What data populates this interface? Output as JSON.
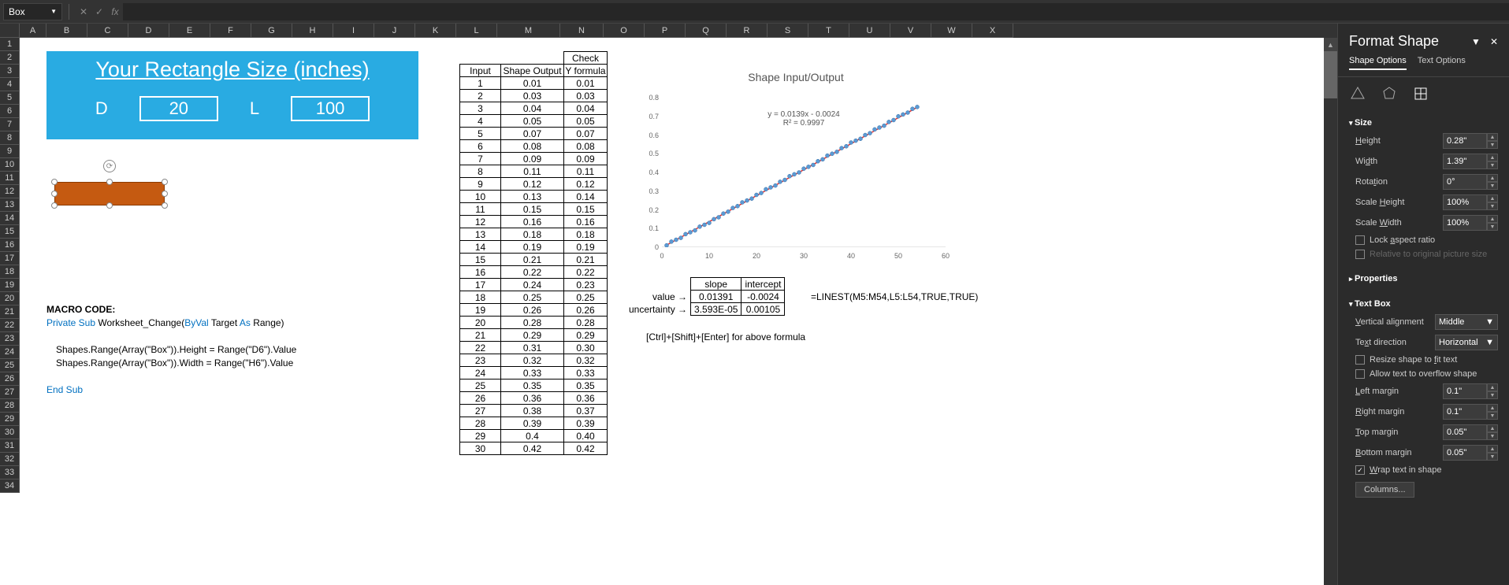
{
  "name_box": "Box",
  "columns": [
    "A",
    "B",
    "C",
    "D",
    "E",
    "F",
    "G",
    "H",
    "I",
    "J",
    "K",
    "L",
    "M",
    "N",
    "O",
    "P",
    "Q",
    "R",
    "S",
    "T",
    "U",
    "V",
    "W",
    "X"
  ],
  "row_count": 34,
  "banner": {
    "title": "Your Rectangle Size (inches)",
    "d_label": "D",
    "d_value": "20",
    "l_label": "L",
    "l_value": "100"
  },
  "macro": {
    "heading": "MACRO CODE:",
    "l1a": "Private Sub",
    "l1b": " Worksheet_Change(",
    "l1c": "ByVal",
    "l1d": " Target ",
    "l1e": "As",
    "l1f": " Range)",
    "l2": "Shapes.Range(Array(\"Box\")).Height = Range(\"D6\").Value",
    "l3": "Shapes.Range(Array(\"Box\")).Width = Range(\"H6\").Value",
    "l4": "End Sub"
  },
  "dtable": {
    "check_label": "Check",
    "h_input": "Input",
    "h_shape": "Shape Output",
    "h_y": "Y formula",
    "rows": [
      [
        "1",
        "0.01",
        "0.01"
      ],
      [
        "2",
        "0.03",
        "0.03"
      ],
      [
        "3",
        "0.04",
        "0.04"
      ],
      [
        "4",
        "0.05",
        "0.05"
      ],
      [
        "5",
        "0.07",
        "0.07"
      ],
      [
        "6",
        "0.08",
        "0.08"
      ],
      [
        "7",
        "0.09",
        "0.09"
      ],
      [
        "8",
        "0.11",
        "0.11"
      ],
      [
        "9",
        "0.12",
        "0.12"
      ],
      [
        "10",
        "0.13",
        "0.14"
      ],
      [
        "11",
        "0.15",
        "0.15"
      ],
      [
        "12",
        "0.16",
        "0.16"
      ],
      [
        "13",
        "0.18",
        "0.18"
      ],
      [
        "14",
        "0.19",
        "0.19"
      ],
      [
        "15",
        "0.21",
        "0.21"
      ],
      [
        "16",
        "0.22",
        "0.22"
      ],
      [
        "17",
        "0.24",
        "0.23"
      ],
      [
        "18",
        "0.25",
        "0.25"
      ],
      [
        "19",
        "0.26",
        "0.26"
      ],
      [
        "20",
        "0.28",
        "0.28"
      ],
      [
        "21",
        "0.29",
        "0.29"
      ],
      [
        "22",
        "0.31",
        "0.30"
      ],
      [
        "23",
        "0.32",
        "0.32"
      ],
      [
        "24",
        "0.33",
        "0.33"
      ],
      [
        "25",
        "0.35",
        "0.35"
      ],
      [
        "26",
        "0.36",
        "0.36"
      ],
      [
        "27",
        "0.38",
        "0.37"
      ],
      [
        "28",
        "0.39",
        "0.39"
      ],
      [
        "29",
        "0.4",
        "0.40"
      ],
      [
        "30",
        "0.42",
        "0.42"
      ]
    ]
  },
  "stats": {
    "h_slope": "slope",
    "h_int": "intercept",
    "r_val": "value →",
    "v_slope": "0.01391",
    "v_int": "-0.0024",
    "r_unc": "uncertainty →",
    "u_slope": "3.593E-05",
    "u_int": "0.00105"
  },
  "formula_text": "=LINEST(M5:M54,L5:L54,TRUE,TRUE)",
  "hint_text": "[Ctrl]+[Shift]+[Enter] for above formula",
  "chart_data": {
    "type": "scatter",
    "title": "Shape Input/Output",
    "xlabel": "",
    "ylabel": "",
    "xlim": [
      0,
      60
    ],
    "ylim": [
      0,
      0.8
    ],
    "x_ticks": [
      0,
      10,
      20,
      30,
      40,
      50,
      60
    ],
    "y_ticks": [
      0,
      0.1,
      0.2,
      0.3,
      0.4,
      0.5,
      0.6,
      0.7,
      0.8
    ],
    "eq": "y = 0.0139x - 0.0024",
    "r2": "R² = 0.9997",
    "series": [
      {
        "name": "Shape Output",
        "x": [
          1,
          2,
          3,
          4,
          5,
          6,
          7,
          8,
          9,
          10,
          11,
          12,
          13,
          14,
          15,
          16,
          17,
          18,
          19,
          20,
          21,
          22,
          23,
          24,
          25,
          26,
          27,
          28,
          29,
          30,
          31,
          32,
          33,
          34,
          35,
          36,
          37,
          38,
          39,
          40,
          41,
          42,
          43,
          44,
          45,
          46,
          47,
          48,
          49,
          50,
          51,
          52,
          53,
          54
        ],
        "y": [
          0.01,
          0.03,
          0.04,
          0.05,
          0.07,
          0.08,
          0.09,
          0.11,
          0.12,
          0.13,
          0.15,
          0.16,
          0.18,
          0.19,
          0.21,
          0.22,
          0.24,
          0.25,
          0.26,
          0.28,
          0.29,
          0.31,
          0.32,
          0.33,
          0.35,
          0.36,
          0.38,
          0.39,
          0.4,
          0.42,
          0.43,
          0.44,
          0.46,
          0.47,
          0.49,
          0.5,
          0.51,
          0.53,
          0.54,
          0.56,
          0.57,
          0.58,
          0.6,
          0.61,
          0.63,
          0.64,
          0.65,
          0.67,
          0.68,
          0.7,
          0.71,
          0.72,
          0.74,
          0.75
        ]
      }
    ],
    "trendline": {
      "slope": 0.0139,
      "intercept": -0.0024
    }
  },
  "panel": {
    "title": "Format Shape",
    "tab1": "Shape Options",
    "tab2": "Text Options",
    "size": {
      "head": "Size",
      "height_l": "Height",
      "height_v": "0.28\"",
      "width_l": "Width",
      "width_v": "1.39\"",
      "rotation_l": "Rotation",
      "rotation_v": "0°",
      "sh_l": "Scale Height",
      "sh_v": "100%",
      "sw_l": "Scale Width",
      "sw_v": "100%",
      "lock": "Lock aspect ratio",
      "relative": "Relative to original picture size"
    },
    "props": {
      "head": "Properties"
    },
    "textbox": {
      "head": "Text Box",
      "va_l": "Vertical alignment",
      "va_v": "Middle",
      "td_l": "Text direction",
      "td_v": "Horizontal",
      "resize": "Resize shape to fit text",
      "overflow": "Allow text to overflow shape",
      "lm_l": "Left margin",
      "lm_v": "0.1\"",
      "rm_l": "Right margin",
      "rm_v": "0.1\"",
      "tm_l": "Top margin",
      "tm_v": "0.05\"",
      "bm_l": "Bottom margin",
      "bm_v": "0.05\"",
      "wrap": "Wrap text in shape",
      "columns": "Columns..."
    }
  }
}
